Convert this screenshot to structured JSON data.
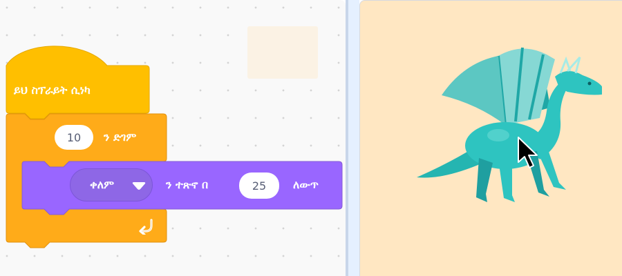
{
  "colors": {
    "hat_block": "#ffbf00",
    "control_block": "#ffab19",
    "looks_block": "#9966ff",
    "stage_background": "#ffe7c2",
    "dragon": "#2ec4c0"
  },
  "blocks": {
    "hat_label": "ይህ ስፕራይት ሲነካ",
    "repeat_count": "10",
    "repeat_label": "ን ድገም",
    "effect_dropdown": "ቀለም",
    "change_label_mid": "ን ተጽኖ በ",
    "change_amount": "25",
    "change_label_end": "ለውጥ"
  },
  "icons": {
    "loop_arrow": "loop-arrow-icon",
    "dropdown_caret": "caret-down-icon",
    "sprite": "dragon-sprite",
    "cursor": "mouse-pointer-icon"
  }
}
